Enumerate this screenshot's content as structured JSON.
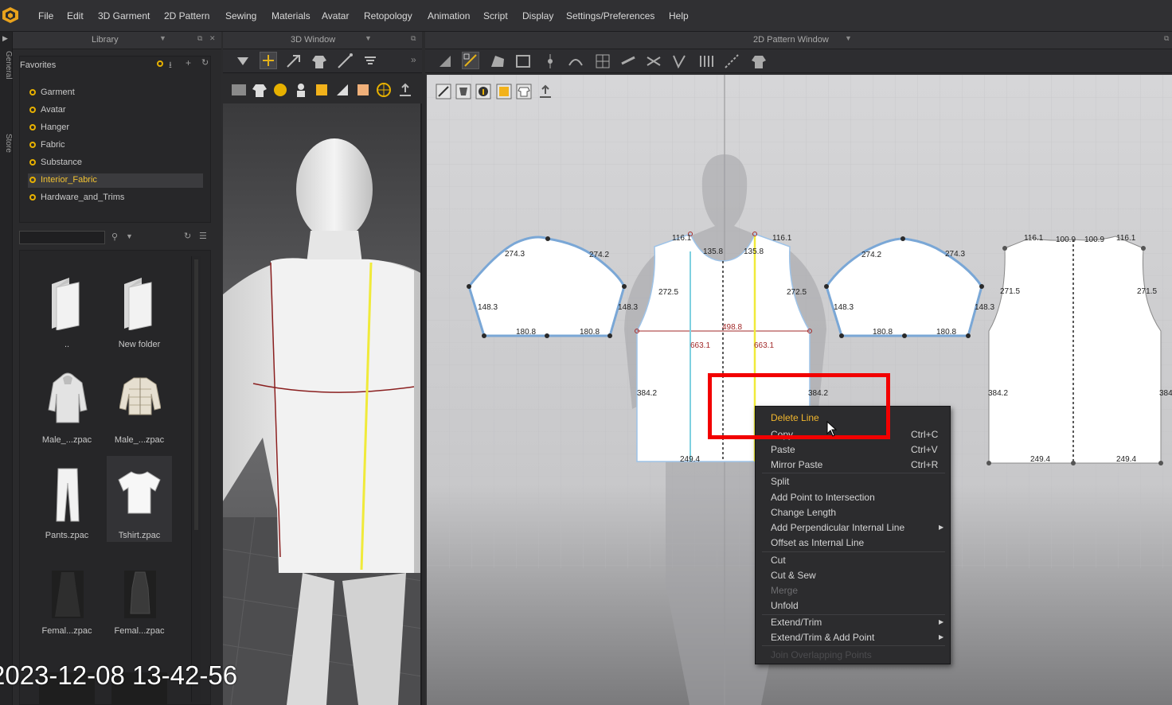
{
  "menubar": {
    "items": [
      "File",
      "Edit",
      "3D Garment",
      "2D Pattern",
      "Sewing",
      "Materials",
      "Avatar",
      "Retopology",
      "Animation",
      "Script",
      "Display",
      "Settings/Preferences",
      "Help"
    ]
  },
  "vtabs": [
    "General",
    "Store"
  ],
  "library": {
    "title": "Library",
    "favorites_label": "Favorites",
    "favorites": [
      "Garment",
      "Avatar",
      "Hanger",
      "Fabric",
      "Substance",
      "Interior_Fabric",
      "Hardware_and_Trims"
    ],
    "selected_favorite": "Interior_Fabric",
    "search_value": "",
    "files": [
      {
        "name": "..",
        "icon": "folder-icon"
      },
      {
        "name": "New folder",
        "icon": "folder-icon"
      },
      {
        "name": "Male_...zpac",
        "icon": "hoodie-icon"
      },
      {
        "name": "Male_...zpac",
        "icon": "puffer-jacket-icon"
      },
      {
        "name": "Pants.zpac",
        "icon": "pants-icon"
      },
      {
        "name": "Tshirt.zpac",
        "icon": "tshirt-icon"
      },
      {
        "name": "Femal...zpac",
        "icon": "dress-icon"
      },
      {
        "name": "Femal...zpac",
        "icon": "dress-icon"
      }
    ]
  },
  "window3d": {
    "title": "3D Window"
  },
  "window2d": {
    "title": "2D Pattern Window"
  },
  "patterns": {
    "sleeve_left": [
      "274.3",
      "274.2",
      "148.3",
      "148.3",
      "180.8",
      "180.8"
    ],
    "front": [
      "116.1",
      "116.1",
      "135.8",
      "135.8",
      "272.5",
      "272.5",
      "498.8",
      "663.1",
      "663.1",
      "384.2",
      "384.2",
      "249.4"
    ],
    "sleeve_right": [
      "274.2",
      "274.3",
      "148.3",
      "148.3",
      "180.8",
      "180.8"
    ],
    "back": [
      "116.1",
      "100.9",
      "100.9",
      "116.1",
      "271.5",
      "271.5",
      "384.2",
      "384",
      "249.4",
      "249.4"
    ]
  },
  "context_menu": {
    "items": [
      {
        "label": "Delete Line",
        "shortcut": "",
        "state": "highlighted"
      },
      {
        "label": "Copy",
        "shortcut": "Ctrl+C",
        "state": "normal"
      },
      {
        "label": "Paste",
        "shortcut": "Ctrl+V",
        "state": "normal"
      },
      {
        "label": "Mirror Paste",
        "shortcut": "Ctrl+R",
        "state": "normal"
      },
      {
        "label": "Split",
        "shortcut": "",
        "state": "normal"
      },
      {
        "label": "Add Point to Intersection",
        "shortcut": "",
        "state": "normal"
      },
      {
        "label": "Change Length",
        "shortcut": "",
        "state": "normal"
      },
      {
        "label": "Add Perpendicular Internal Line",
        "shortcut": "",
        "state": "submenu"
      },
      {
        "label": "Offset as Internal Line",
        "shortcut": "",
        "state": "normal"
      },
      {
        "label": "Cut",
        "shortcut": "",
        "state": "normal"
      },
      {
        "label": "Cut & Sew",
        "shortcut": "",
        "state": "normal"
      },
      {
        "label": "Merge",
        "shortcut": "",
        "state": "disabled"
      },
      {
        "label": "Unfold",
        "shortcut": "",
        "state": "normal"
      },
      {
        "label": "Extend/Trim",
        "shortcut": "",
        "state": "submenu"
      },
      {
        "label": "Extend/Trim & Add Point",
        "shortcut": "",
        "state": "submenu"
      },
      {
        "label": "Join Overlapping Points",
        "shortcut": "",
        "state": "disabled"
      }
    ]
  },
  "overlay": {
    "timestamp": "2023-12-08 13-42-56"
  },
  "colors": {
    "accent": "#f1b62d",
    "highlight_box": "#f20000",
    "pattern_outline": "#7aa7d6",
    "seam_yellow": "#f0ea3a",
    "internal_red": "#a22a2a"
  }
}
